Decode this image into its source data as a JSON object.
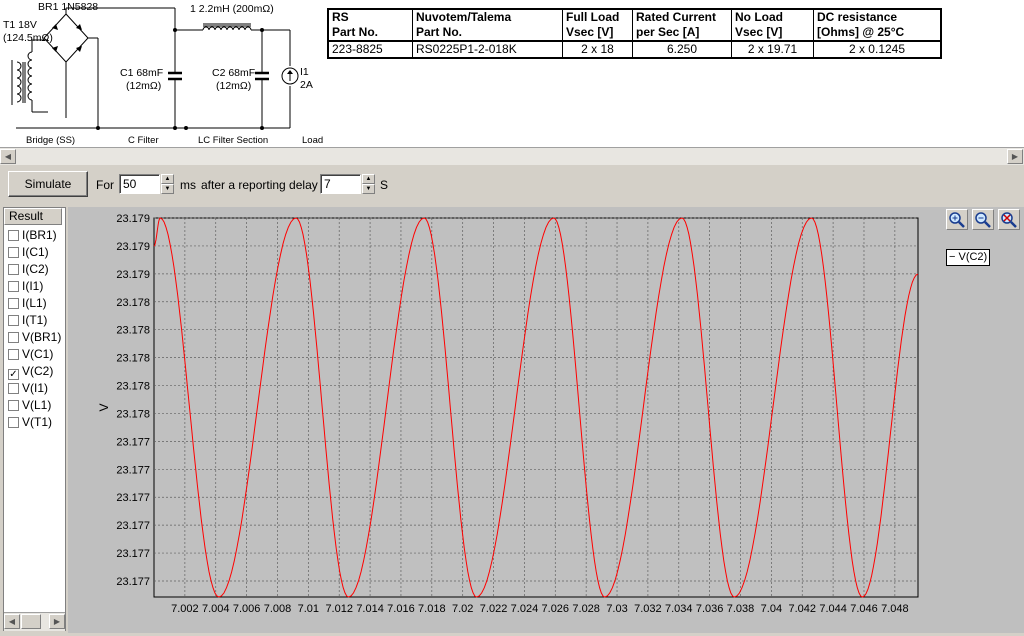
{
  "schematic": {
    "bridge_ref": "BR1 1N5828",
    "inductor_label": "1 2.2mH (200mΩ)",
    "transformer_label": "T1 18V",
    "transformer_res": "(124.5mΩ)",
    "c1_label": "C1 68mF",
    "c1_res": "(12mΩ)",
    "c2_label": "C2 68mF",
    "c2_res": "(12mΩ)",
    "load_ref": "I1",
    "load_value": "2A",
    "section_bridge": "Bridge (SS)",
    "section_cfilter": "C Filter",
    "section_lcfilter": "LC Filter Section",
    "section_load": "Load"
  },
  "spec_table": {
    "headers": [
      [
        "RS",
        "Part No."
      ],
      [
        "Nuvotem/Talema",
        "Part No."
      ],
      [
        "Full Load",
        "Vsec [V]"
      ],
      [
        "Rated Current",
        "per Sec [A]"
      ],
      [
        "No Load",
        "Vsec [V]"
      ],
      [
        "DC resistance",
        "[Ohms] @ 25°C"
      ]
    ],
    "row": [
      "223-8825",
      "RS0225P1-2-018K",
      "2 x 18",
      "6.250",
      "2 x 19.71",
      "2 x 0.1245"
    ]
  },
  "toolbar": {
    "simulate_label": "Simulate",
    "for_label": "For",
    "duration_value": "50",
    "ms_label": "ms",
    "after_label": "after a reporting delay of",
    "delay_value": "7",
    "s_label": "S"
  },
  "results": {
    "header": "Result",
    "items": [
      {
        "label": "I(BR1)",
        "checked": false
      },
      {
        "label": "I(C1)",
        "checked": false
      },
      {
        "label": "I(C2)",
        "checked": false
      },
      {
        "label": "I(I1)",
        "checked": false
      },
      {
        "label": "I(L1)",
        "checked": false
      },
      {
        "label": "I(T1)",
        "checked": false
      },
      {
        "label": "V(BR1)",
        "checked": false
      },
      {
        "label": "V(C1)",
        "checked": false
      },
      {
        "label": "V(C2)",
        "checked": true
      },
      {
        "label": "V(I1)",
        "checked": false
      },
      {
        "label": "V(L1)",
        "checked": false
      },
      {
        "label": "V(T1)",
        "checked": false
      }
    ]
  },
  "legend": {
    "label": "− V(C2)"
  },
  "colors": {
    "trace": "#ff0000",
    "plot_bg": "#c0c0c0",
    "grid": "#606060"
  },
  "chart_data": {
    "type": "line",
    "xlabel": "",
    "ylabel": "V",
    "xlim": [
      7.0,
      7.0495
    ],
    "ylim": [
      23.1766,
      23.1793
    ],
    "y_tick_labels": [
      "23.179",
      "23.179",
      "23.179",
      "23.178",
      "23.178",
      "23.178",
      "23.178",
      "23.178",
      "23.177",
      "23.177",
      "23.177",
      "23.177",
      "23.177",
      "23.177"
    ],
    "x_ticks": [
      7.002,
      7.004,
      7.006,
      7.008,
      7.01,
      7.012,
      7.014,
      7.016,
      7.018,
      7.02,
      7.022,
      7.024,
      7.026,
      7.028,
      7.03,
      7.032,
      7.034,
      7.036,
      7.038,
      7.04,
      7.042,
      7.044,
      7.046,
      7.048
    ],
    "x_tick_labels": [
      "7.002",
      "7.004",
      "7.006",
      "7.008",
      "7.01",
      "7.012",
      "7.014",
      "7.016",
      "7.018",
      "7.02",
      "7.022",
      "7.024",
      "7.026",
      "7.028",
      "7.03",
      "7.032",
      "7.034",
      "7.036",
      "7.038",
      "7.04",
      "7.042",
      "7.044",
      "7.046",
      "7.048"
    ],
    "grid": true,
    "series": [
      {
        "name": "V(C2)",
        "x": [
          7.0,
          7.0004,
          7.0042,
          7.0092,
          7.0126,
          7.0175,
          7.0209,
          7.0259,
          7.0292,
          7.0342,
          7.0376,
          7.0426,
          7.0459,
          7.0495
        ],
        "y": [
          23.1791,
          23.1793,
          23.1766,
          23.1793,
          23.1766,
          23.1793,
          23.1766,
          23.1793,
          23.1766,
          23.1793,
          23.1766,
          23.1793,
          23.1766,
          23.1789
        ]
      }
    ]
  }
}
